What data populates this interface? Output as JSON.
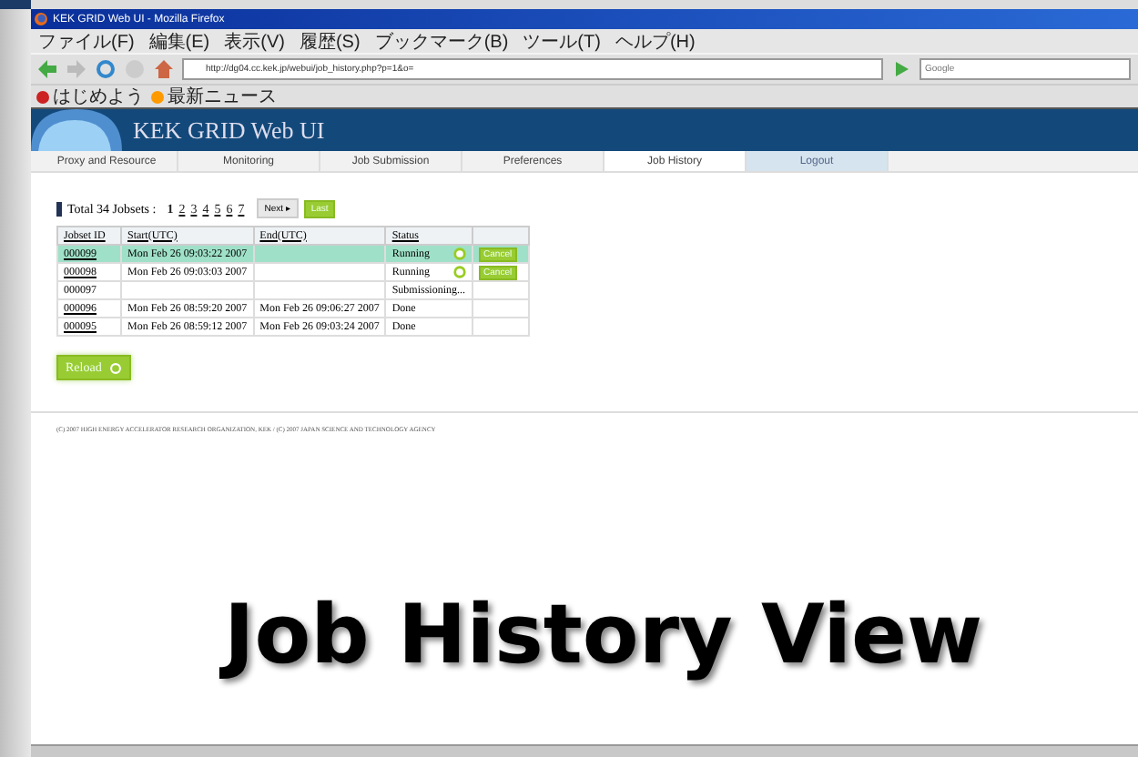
{
  "window": {
    "title": "KEK GRID Web UI - Mozilla Firefox"
  },
  "menu": [
    "ファイル(F)",
    "編集(E)",
    "表示(V)",
    "履歴(S)",
    "ブックマーク(B)",
    "ツール(T)",
    "ヘルプ(H)"
  ],
  "address": {
    "value": "http://dg04.cc.kek.jp/webui/job_history.php?p=1&o="
  },
  "search": {
    "placeholder": "Google"
  },
  "bookmarks": [
    "はじめよう",
    "最新ニュース"
  ],
  "site": {
    "title": "KEK GRID Web UI"
  },
  "tabs": [
    {
      "label": "Proxy and Resource",
      "selected": false,
      "kind": "tab"
    },
    {
      "label": "Monitoring",
      "selected": false,
      "kind": "tab"
    },
    {
      "label": "Job Submission",
      "selected": false,
      "kind": "tab"
    },
    {
      "label": "Preferences",
      "selected": false,
      "kind": "tab"
    },
    {
      "label": "Job History",
      "selected": true,
      "kind": "tab"
    },
    {
      "label": "Logout",
      "selected": false,
      "kind": "logout"
    }
  ],
  "pager": {
    "total": "Total 34 Jobsets :",
    "pages": [
      {
        "label": "1",
        "selected": true
      },
      {
        "label": "2",
        "selected": false
      },
      {
        "label": "3",
        "selected": false
      },
      {
        "label": "4",
        "selected": false
      },
      {
        "label": "5",
        "selected": false
      },
      {
        "label": "6",
        "selected": false
      },
      {
        "label": "7",
        "selected": false
      }
    ],
    "next": "Next ▸",
    "last": "Last"
  },
  "table": {
    "columns": [
      "Jobset ID",
      "Start(UTC)",
      "End(UTC)",
      "Status"
    ],
    "rows": [
      {
        "id": "000099",
        "linked": true,
        "selected": true,
        "start": "Mon Feb 26 09:03:22 2007",
        "end": "",
        "status": "Running",
        "kind": "running",
        "action": "Cancel"
      },
      {
        "id": "000098",
        "linked": true,
        "selected": false,
        "start": "Mon Feb 26 09:03:03 2007",
        "end": "",
        "status": "Running",
        "kind": "running",
        "action": "Cancel"
      },
      {
        "id": "000097",
        "linked": false,
        "selected": false,
        "start": "",
        "end": "",
        "status": "Submissioning...",
        "kind": "plain"
      },
      {
        "id": "000096",
        "linked": true,
        "selected": false,
        "start": "Mon Feb 26 08:59:20 2007",
        "end": "Mon Feb 26 09:06:27 2007",
        "status": "Done",
        "kind": "plain"
      },
      {
        "id": "000095",
        "linked": true,
        "selected": false,
        "start": "Mon Feb 26 08:59:12 2007",
        "end": "Mon Feb 26 09:03:24 2007",
        "status": "Done",
        "kind": "plain"
      }
    ]
  },
  "reload": "Reload",
  "footer": "(C) 2007 HIGH ENERGY ACCELERATOR RESEARCH ORGANIZATION, KEK / (C) 2007 JAPAN SCIENCE AND TECHNOLOGY AGENCY",
  "caption": "Job History View"
}
